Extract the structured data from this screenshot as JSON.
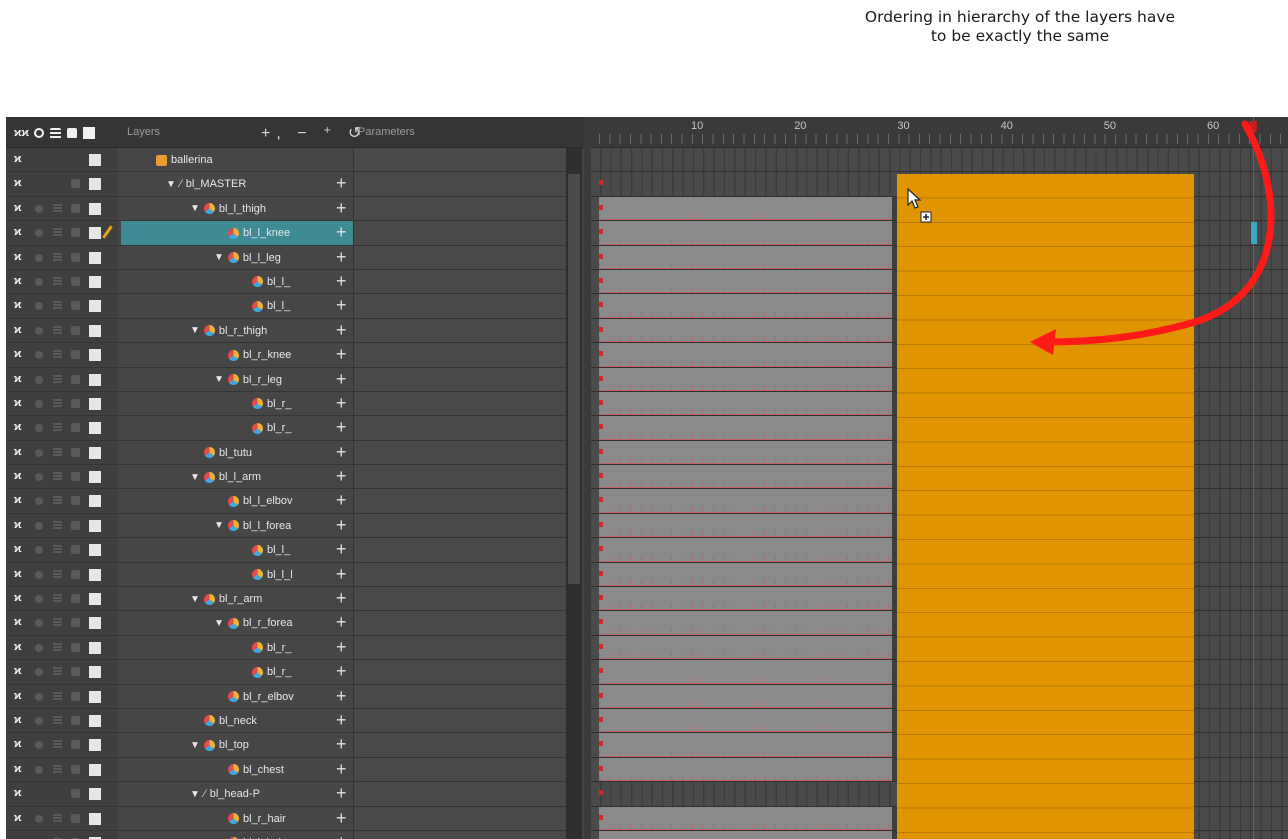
{
  "annotation": {
    "line1": "Ordering in hierarchy of the layers have",
    "line2": "to be exactly the same"
  },
  "header": {
    "layers_label": "Layers",
    "parameters_label": "Parameters",
    "tools": "+, − ⁺ ↺"
  },
  "timeline": {
    "frame_numbers": [
      "10",
      "20",
      "30",
      "40",
      "50",
      "60"
    ]
  },
  "layers": [
    {
      "name": "ballerina",
      "type": "group"
    },
    {
      "name": "bl_MASTER",
      "type": "peg"
    },
    {
      "name": "bl_l_thigh",
      "type": "drawing"
    },
    {
      "name": "bl_l_knee",
      "type": "drawing"
    },
    {
      "name": "bl_l_leg",
      "type": "drawing"
    },
    {
      "name": "bl_l_",
      "type": "drawing"
    },
    {
      "name": "bl_l_",
      "type": "drawing"
    },
    {
      "name": "bl_r_thigh",
      "type": "drawing"
    },
    {
      "name": "bl_r_knee",
      "type": "drawing"
    },
    {
      "name": "bl_r_leg",
      "type": "drawing"
    },
    {
      "name": "bl_r_",
      "type": "drawing"
    },
    {
      "name": "bl_r_",
      "type": "drawing"
    },
    {
      "name": "bl_tutu",
      "type": "drawing"
    },
    {
      "name": "bl_l_arm",
      "type": "drawing"
    },
    {
      "name": "bl_l_elbov",
      "type": "drawing"
    },
    {
      "name": "bl_l_forea",
      "type": "drawing"
    },
    {
      "name": "bl_l_",
      "type": "drawing"
    },
    {
      "name": "bl_l_l",
      "type": "drawing"
    },
    {
      "name": "bl_r_arm",
      "type": "drawing"
    },
    {
      "name": "bl_r_forea",
      "type": "drawing"
    },
    {
      "name": "bl_r_",
      "type": "drawing"
    },
    {
      "name": "bl_r_",
      "type": "drawing"
    },
    {
      "name": "bl_r_elbov",
      "type": "drawing"
    },
    {
      "name": "bl_neck",
      "type": "drawing"
    },
    {
      "name": "bl_top",
      "type": "drawing"
    },
    {
      "name": "bl_chest",
      "type": "drawing"
    },
    {
      "name": "bl_head-P",
      "type": "peg"
    },
    {
      "name": "bl_r_hair",
      "type": "drawing"
    },
    {
      "name": "bl_l_hair",
      "type": "drawing"
    }
  ],
  "selected_layer": "bl_l_knee",
  "colors": {
    "accent_selected": "#3e8b96",
    "pasted_block": "#e09400",
    "arrow": "#ff1a1a"
  }
}
